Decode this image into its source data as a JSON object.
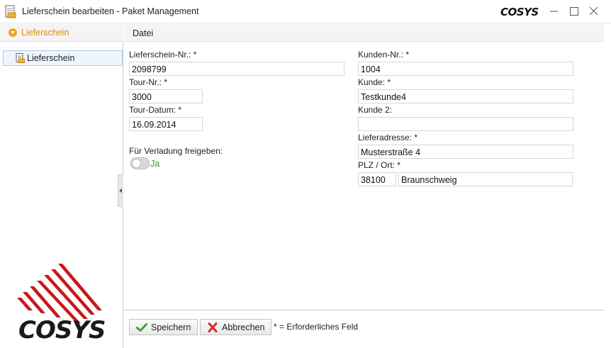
{
  "window": {
    "title": "Lieferschein bearbeiten - Paket Management",
    "logo_text": "COSYS"
  },
  "sidebar": {
    "header": "Lieferschein",
    "items": [
      {
        "label": "Lieferschein",
        "selected": true
      }
    ]
  },
  "menu": {
    "items": [
      "Datei"
    ]
  },
  "form": {
    "lieferschein_nr": {
      "label": "Lieferschein-Nr.: *",
      "value": "2098799"
    },
    "tour_nr": {
      "label": "Tour-Nr.: *",
      "value": "3000"
    },
    "tour_datum": {
      "label": "Tour-Datum: *",
      "value": "16.09.2014"
    },
    "verladung": {
      "label": "Für Verladung freigeben:",
      "value_label": "Ja",
      "enabled": true
    },
    "kunden_nr": {
      "label": "Kunden-Nr.: *",
      "value": "1004"
    },
    "kunde": {
      "label": "Kunde: *",
      "value": "Testkunde4"
    },
    "kunde2": {
      "label": "Kunde 2:",
      "value": ""
    },
    "lieferadresse": {
      "label": "Lieferadresse: *",
      "value": "Musterstraße 4"
    },
    "plz_ort": {
      "label": "PLZ / Ort: *",
      "plz": "38100",
      "ort": "Braunschweig"
    }
  },
  "footer": {
    "save_label": "Speichern",
    "cancel_label": "Abbrechen",
    "required_note": "* = Erforderliches Feld"
  },
  "colors": {
    "accent_orange": "#e38a00",
    "toggle_on_text": "#2a9a3c",
    "logo_red": "#c8171b",
    "logo_dark": "#1a1a1a"
  }
}
